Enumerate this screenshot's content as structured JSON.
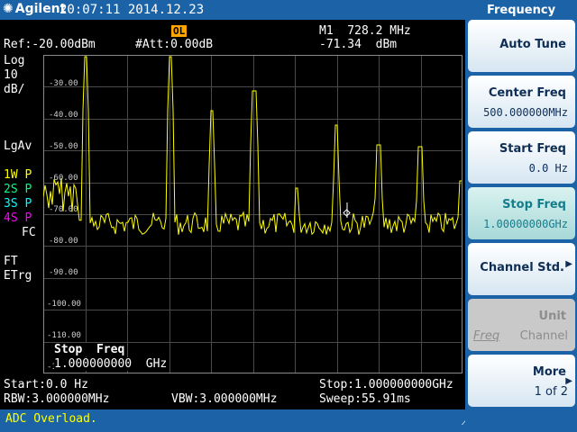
{
  "header": {
    "brand": "Agilent",
    "datetime": "20:07:11  2014.12.23",
    "ol_badge": "OL"
  },
  "measure": {
    "ref_level": "Ref:-20.00dBm",
    "attenuation": "#Att:0.00dB",
    "marker_freq": "M1  728.2 MHz",
    "marker_amp": "-71.34  dBm",
    "scale_type": "Log",
    "scale_value": "10",
    "scale_unit": "dB/",
    "avg_mode": "LgAv",
    "traces": [
      {
        "label": "1W P",
        "color": "#ffff00"
      },
      {
        "label": "2S P",
        "color": "#00ff7f"
      },
      {
        "label": "3S P",
        "color": "#00ffff"
      },
      {
        "label": "4S P",
        "color": "#ff00ff"
      }
    ],
    "fc": "FC",
    "ft": "FT",
    "etrg": "ETrg",
    "y_ticks": [
      "-30.00",
      "-40.00",
      "-50.00",
      "-60.00",
      "-70.00",
      "-80.00",
      "-90.00",
      "-100.00",
      "-110.00",
      "-120.00"
    ],
    "active_function_label": "Stop  Freq",
    "active_function_value": "1.000000000  GHz",
    "start": "Start:0.0 Hz",
    "stop": "Stop:1.000000000GHz",
    "rbw": "RBW:3.000000MHz",
    "vbw": "VBW:3.000000MHz",
    "sweep": "Sweep:55.91ms"
  },
  "status": {
    "message": "ADC Overload."
  },
  "menu": {
    "title": "Frequency",
    "softkeys": [
      {
        "label": "Auto Tune",
        "value": ""
      },
      {
        "label": "Center Freq",
        "value": "500.000000MHz"
      },
      {
        "label": "Start Freq",
        "value": "0.0 Hz"
      },
      {
        "label": "Stop Freq",
        "value": "1.00000000GHz"
      },
      {
        "label": "Channel Std.",
        "value": ""
      },
      {
        "label": "Unit",
        "value_left": "Freq",
        "value_right": "Channel"
      },
      {
        "label": "More",
        "value": "1 of 2"
      }
    ]
  },
  "colors": {
    "accent": "#1b63a6",
    "trace": "#ffff00",
    "status_text": "#ffff00",
    "ol_badge": "#ffa500"
  }
}
